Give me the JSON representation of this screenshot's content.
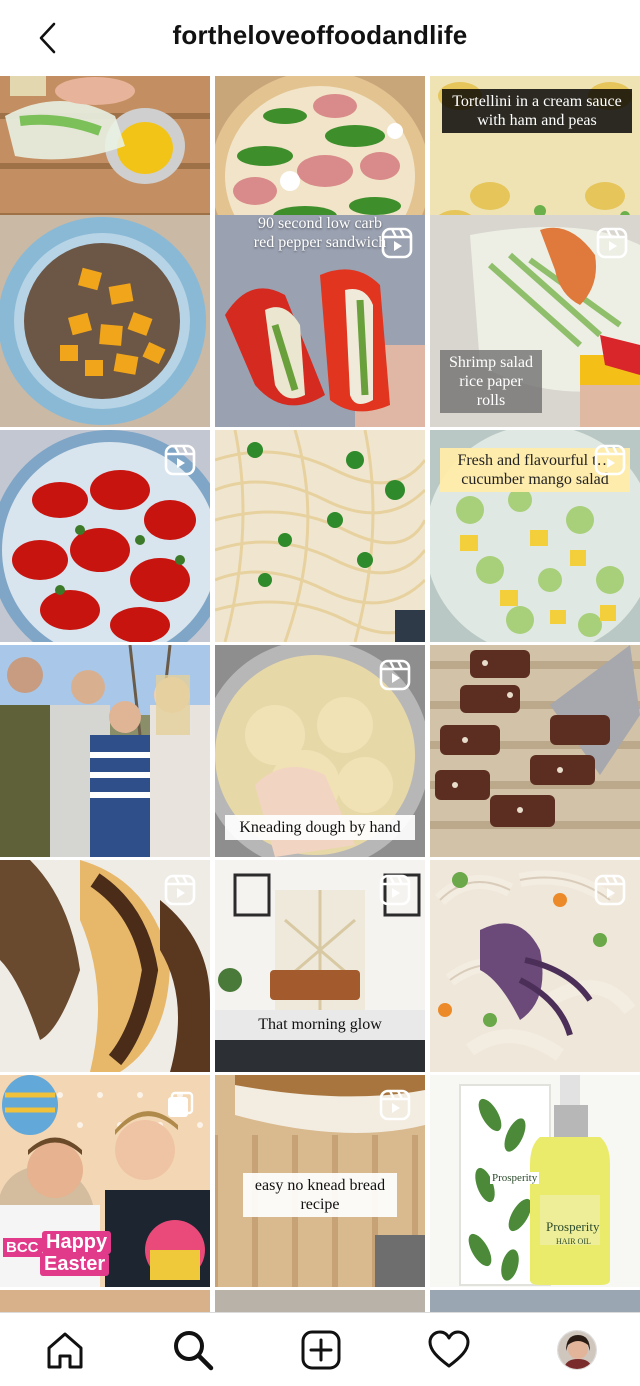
{
  "header": {
    "title": "fortheloveoffoodandlife",
    "back_icon": "chevron-left-icon"
  },
  "tiles": [
    {
      "name": "tile-spring-rolls-dip",
      "caption": "",
      "reel": false,
      "caption_style": ""
    },
    {
      "name": "tile-prosciutto-arugula-pizza",
      "caption": "",
      "reel": false,
      "caption_style": ""
    },
    {
      "name": "tile-tortellini-cream",
      "caption": "Tortellini in a cream sauce with ham and peas",
      "reel": false,
      "caption_style": "cap-dark"
    },
    {
      "name": "tile-mango-bowl",
      "caption": "",
      "reel": false,
      "caption_style": ""
    },
    {
      "name": "tile-pepper-sandwich",
      "caption": "90 second low carb red pepper sandwich",
      "reel": true,
      "caption_style": "cap-plain"
    },
    {
      "name": "tile-shrimp-salad-rolls",
      "caption": "Shrimp salad rice paper rolls",
      "reel": true,
      "caption_style": "cap-gray"
    },
    {
      "name": "tile-roasted-peppers",
      "caption": "",
      "reel": true,
      "caption_style": ""
    },
    {
      "name": "tile-spaghetti",
      "caption": "",
      "reel": false,
      "caption_style": ""
    },
    {
      "name": "tile-cucumber-mango-salad",
      "caption": "Fresh and flavourful t… cucumber mango salad",
      "reel": true,
      "caption_style": "cap-yellow"
    },
    {
      "name": "tile-family-photo",
      "caption": "",
      "reel": false,
      "caption_style": ""
    },
    {
      "name": "tile-kneading-dough",
      "caption": "Kneading dough by hand",
      "reel": true,
      "caption_style": "cap-light"
    },
    {
      "name": "tile-chocolate-salami",
      "caption": "",
      "reel": false,
      "caption_style": ""
    },
    {
      "name": "tile-babka-bread",
      "caption": "",
      "reel": true,
      "caption_style": ""
    },
    {
      "name": "tile-morning-glow-room",
      "caption": "That morning glow",
      "reel": true,
      "caption_style": "cap-light"
    },
    {
      "name": "tile-squid-pasta-salad",
      "caption": "",
      "reel": true,
      "caption_style": ""
    },
    {
      "name": "tile-happy-easter",
      "caption": "",
      "reel": false,
      "caption_style": "",
      "badge_text": "BCC",
      "overlay_text_1": "Happy",
      "overlay_text_2": "Easter"
    },
    {
      "name": "tile-no-knead-bread",
      "caption": "easy no knead bread recipe",
      "reel": true,
      "caption_style": "cap-light"
    },
    {
      "name": "tile-hair-oil",
      "caption": "",
      "reel": false,
      "caption_style": "",
      "product_text_1": "Prosperity",
      "product_text_2": "HAIR OIL"
    }
  ],
  "bottom_nav": {
    "items": [
      {
        "name": "home-icon"
      },
      {
        "name": "search-icon"
      },
      {
        "name": "create-post-icon"
      },
      {
        "name": "heart-icon"
      },
      {
        "name": "profile-avatar"
      }
    ]
  },
  "colors": {
    "accent_icon": "#111111",
    "border": "#dbdbdb"
  }
}
